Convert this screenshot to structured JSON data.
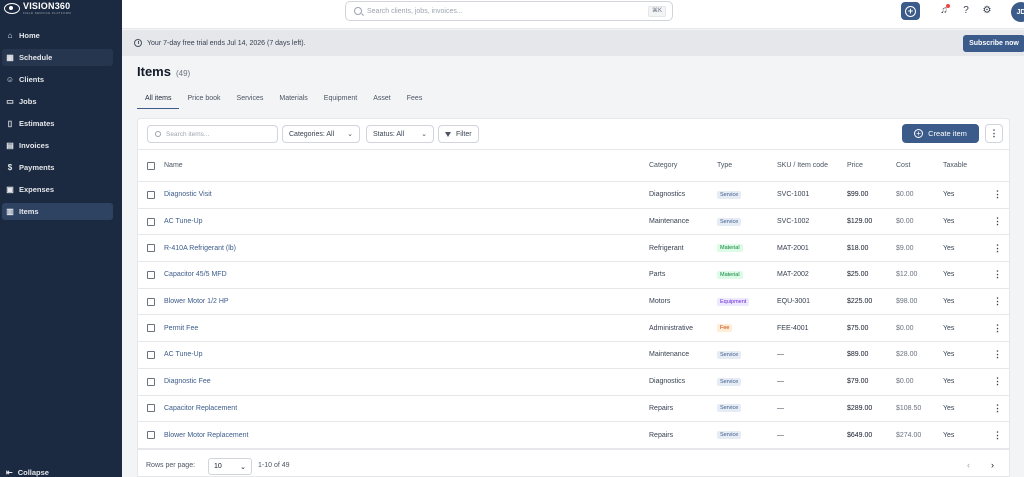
{
  "brand": {
    "name": "VISION360",
    "tagline": "FIELD SERVICE PLATFORM"
  },
  "sidebar": {
    "items": [
      {
        "label": "Home",
        "icon": "home-icon"
      },
      {
        "label": "Schedule",
        "icon": "calendar-icon"
      },
      {
        "label": "Clients",
        "icon": "users-icon"
      },
      {
        "label": "Jobs",
        "icon": "briefcase-icon"
      },
      {
        "label": "Estimates",
        "icon": "document-icon"
      },
      {
        "label": "Invoices",
        "icon": "receipt-icon"
      },
      {
        "label": "Payments",
        "icon": "dollar-icon"
      },
      {
        "label": "Expenses",
        "icon": "wallet-icon"
      },
      {
        "label": "Items",
        "icon": "box-icon"
      }
    ],
    "active": "Items",
    "collapse_label": "Collapse"
  },
  "topbar": {
    "search_placeholder": "Search clients, jobs, invoices...",
    "search_shortcut": "⌘K",
    "avatar_initials": "JD"
  },
  "banner": {
    "text": "Your 7-day free trial ends Jul 14, 2026 (7 days left).",
    "cta": "Subscribe now"
  },
  "page": {
    "title": "Items",
    "count": "(49)",
    "tabs": [
      "All items",
      "Price book",
      "Services",
      "Materials",
      "Equipment",
      "Asset",
      "Fees"
    ],
    "active_tab": "All items"
  },
  "toolbar": {
    "search_placeholder": "Search items...",
    "categories": "Categories: All",
    "status": "Status: All",
    "filter": "Filter",
    "create": "Create item"
  },
  "table": {
    "headers": {
      "name": "Name",
      "category": "Category",
      "type": "Type",
      "sku": "SKU / Item code",
      "price": "Price",
      "cost": "Cost",
      "taxable": "Taxable"
    },
    "rows": [
      {
        "name": "Diagnostic Visit",
        "category": "Diagnostics",
        "type": "Service",
        "sku": "SVC-1001",
        "price": "$99.00",
        "cost": "$0.00",
        "taxable": "Yes"
      },
      {
        "name": "AC Tune-Up",
        "category": "Maintenance",
        "type": "Service",
        "sku": "SVC-1002",
        "price": "$129.00",
        "cost": "$0.00",
        "taxable": "Yes"
      },
      {
        "name": "R-410A Refrigerant (lb)",
        "category": "Refrigerant",
        "type": "Material",
        "sku": "MAT-2001",
        "price": "$18.00",
        "cost": "$9.00",
        "taxable": "Yes"
      },
      {
        "name": "Capacitor 45/5 MFD",
        "category": "Parts",
        "type": "Material",
        "sku": "MAT-2002",
        "price": "$25.00",
        "cost": "$12.00",
        "taxable": "Yes"
      },
      {
        "name": "Blower Motor 1/2 HP",
        "category": "Motors",
        "type": "Equipment",
        "sku": "EQU-3001",
        "price": "$225.00",
        "cost": "$98.00",
        "taxable": "Yes"
      },
      {
        "name": "Permit Fee",
        "category": "Administrative",
        "type": "Fee",
        "sku": "FEE-4001",
        "price": "$75.00",
        "cost": "$0.00",
        "taxable": "Yes"
      },
      {
        "name": "AC Tune-Up",
        "category": "Maintenance",
        "type": "Service",
        "sku": "—",
        "price": "$89.00",
        "cost": "$28.00",
        "taxable": "Yes"
      },
      {
        "name": "Diagnostic Fee",
        "category": "Diagnostics",
        "type": "Service",
        "sku": "—",
        "price": "$79.00",
        "cost": "$0.00",
        "taxable": "Yes"
      },
      {
        "name": "Capacitor Replacement",
        "category": "Repairs",
        "type": "Service",
        "sku": "—",
        "price": "$289.00",
        "cost": "$108.50",
        "taxable": "Yes"
      },
      {
        "name": "Blower Motor Replacement",
        "category": "Repairs",
        "type": "Service",
        "sku": "—",
        "price": "$649.00",
        "cost": "$274.00",
        "taxable": "Yes"
      }
    ]
  },
  "pagination": {
    "rows_label": "Rows per page:",
    "rows_value": "10",
    "range": "1-10 of 49"
  },
  "colors": {
    "sidebar_bg": "#1b2a41",
    "accent": "#3b5b8a",
    "service": "#e6ecf5",
    "material": "#dcfce7",
    "equipment": "#ede9fe",
    "fee": "#ffedd5"
  }
}
